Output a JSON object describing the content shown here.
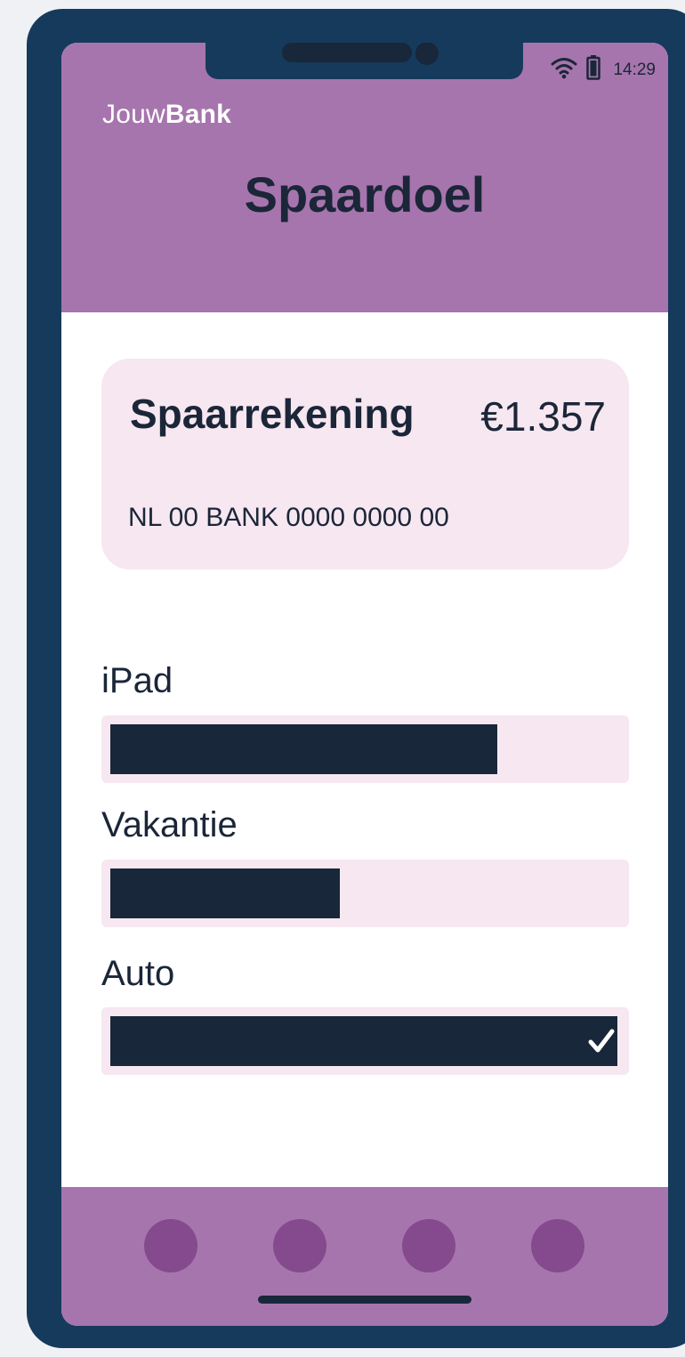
{
  "status_bar": {
    "time": "14:29",
    "wifi_icon": "wifi-icon",
    "battery_icon": "battery-icon"
  },
  "brand": {
    "part1": "Jouw",
    "part2": "Bank"
  },
  "page": {
    "title": "Spaardoel"
  },
  "account": {
    "name": "Spaarrekening",
    "balance": "€1.357",
    "iban": "NL 00 BANK 0000 0000 00"
  },
  "goals": [
    {
      "label": "iPad",
      "progress": 0.76,
      "complete": false
    },
    {
      "label": "Vakantie",
      "progress": 0.45,
      "complete": false
    },
    {
      "label": "Auto",
      "progress": 1.0,
      "complete": true
    }
  ],
  "nav": {
    "items": [
      "nav-item-1",
      "nav-item-2",
      "nav-item-3",
      "nav-item-4"
    ]
  },
  "colors": {
    "frame": "#163a5c",
    "header": "#a675ad",
    "card": "#f6e7f1",
    "text": "#1b2638",
    "fill": "#18273a",
    "nav_dot": "#854a8d"
  }
}
